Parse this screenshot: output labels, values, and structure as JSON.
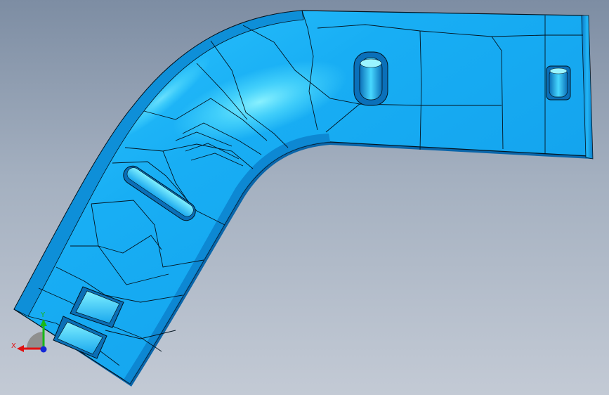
{
  "viewport": {
    "background_top": "#7d8da3",
    "background_bottom": "#c3cad5"
  },
  "part": {
    "body_color": "#18aef4",
    "highlight_color": "#5fe6ff",
    "shadow_color": "#0b6fb8",
    "edge_color": "#031420"
  },
  "triad": {
    "x_label": "X",
    "y_label": "Y",
    "x_color": "#e01010",
    "y_color": "#18b818",
    "z_color": "#1428d8"
  }
}
